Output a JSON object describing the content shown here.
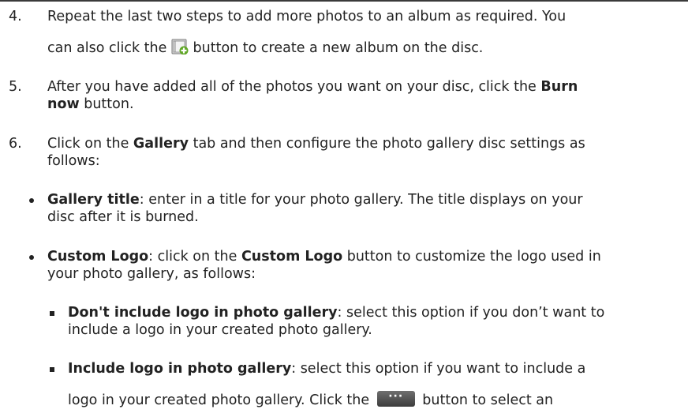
{
  "steps": [
    {
      "num": "4.",
      "line1": "Repeat the last two steps to add more photos to an album as required. You",
      "line2_before": "can also click the",
      "line2_after": "button to create a new album on the disc."
    },
    {
      "num": "5.",
      "line1_before": "After you have added all of the photos you want on your disc, click the",
      "line1_bold": "Burn",
      "line2_bold": "now",
      "line2_after": "button."
    },
    {
      "num": "6.",
      "line1_before": "Click on the",
      "line1_bold": "Gallery",
      "line1_after": "tab and then configure the photo gallery disc settings as",
      "line2": "follows:"
    }
  ],
  "bullets": [
    {
      "bold": "Gallery title",
      "line1": ": enter in a title for your photo gallery. The title displays on your",
      "line2": "disc after it is burned."
    },
    {
      "bold": "Custom Logo",
      "line1_mid": ": click on the",
      "line1_bold2": "Custom Logo",
      "line1_after": "button to customize the logo used in",
      "line2": "your photo gallery, as follows:"
    }
  ],
  "subbullets": [
    {
      "bold": "Don't include logo in photo gallery",
      "line1": ": select this option if you don’t want to",
      "line2": "include a logo in your created photo gallery."
    },
    {
      "bold": "Include logo in photo gallery",
      "line1": ": select this option if you want to include a",
      "line2_before": "logo in your created photo gallery. Click the",
      "line2_after": "button to select an"
    }
  ],
  "icons": {
    "new_album": "new-album-icon",
    "browse": "more-options-icon"
  },
  "colors": {
    "text": "#222222",
    "icon_green": "#5fa624"
  }
}
